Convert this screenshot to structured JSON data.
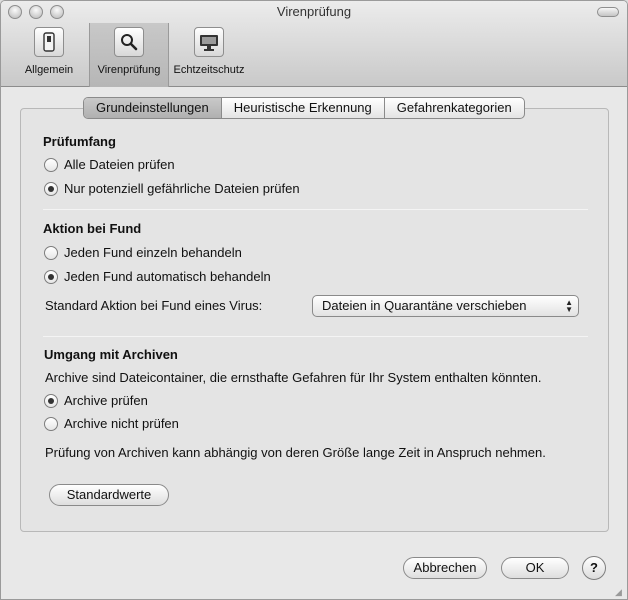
{
  "window": {
    "title": "Virenprüfung"
  },
  "toolbar": {
    "items": [
      {
        "label": "Allgemein",
        "icon": "switch-icon"
      },
      {
        "label": "Virenprüfung",
        "icon": "magnifier-icon"
      },
      {
        "label": "Echtzeitschutz",
        "icon": "monitor-icon"
      }
    ],
    "selected": "Virenprüfung"
  },
  "tabs": {
    "items": [
      "Grundeinstellungen",
      "Heuristische Erkennung",
      "Gefahrenkategorien"
    ],
    "active": "Grundeinstellungen"
  },
  "pruefumfang": {
    "title": "Prüfumfang",
    "options": [
      "Alle Dateien prüfen",
      "Nur potenziell gefährliche Dateien prüfen"
    ],
    "selected_index": 1
  },
  "aktion": {
    "title": "Aktion bei Fund",
    "options": [
      "Jeden Fund einzeln behandeln",
      "Jeden Fund automatisch behandeln"
    ],
    "selected_index": 1,
    "standard_label": "Standard Aktion bei Fund eines Virus:",
    "standard_value": "Dateien in Quarantäne verschieben"
  },
  "archive": {
    "title": "Umgang mit Archiven",
    "description": "Archive sind Dateicontainer, die ernsthafte Gefahren für Ihr System enthalten könnten.",
    "options": [
      "Archive prüfen",
      "Archive nicht prüfen"
    ],
    "selected_index": 0,
    "note": "Prüfung von Archiven kann abhängig von deren Größe lange Zeit in Anspruch nehmen."
  },
  "buttons": {
    "defaults": "Standardwerte",
    "cancel": "Abbrechen",
    "ok": "OK",
    "help": "?"
  }
}
